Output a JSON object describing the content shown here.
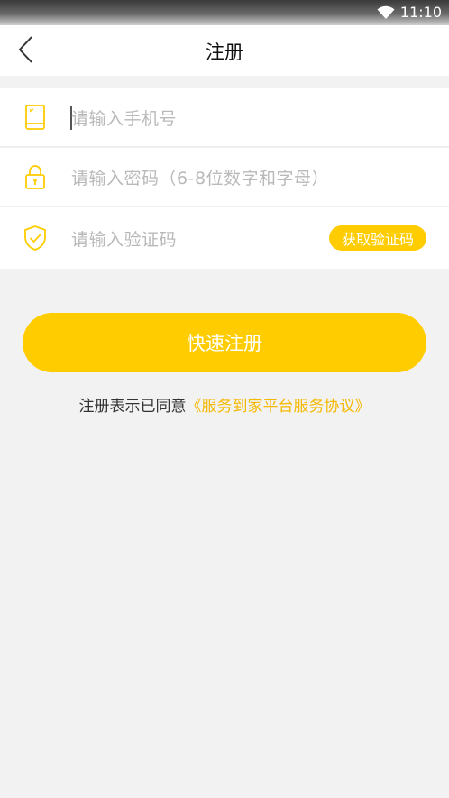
{
  "status_bar": {
    "time": "11:10",
    "wifi_icon": "wifi-icon"
  },
  "header": {
    "back_icon": "chevron-left-icon",
    "title": "注册"
  },
  "form": {
    "phone": {
      "icon": "phone-icon",
      "placeholder": "请输入手机号"
    },
    "password": {
      "icon": "lock-icon",
      "placeholder": "请输入密码（6-8位数字和字母）"
    },
    "code": {
      "icon": "shield-check-icon",
      "placeholder": "请输入验证码",
      "button_label": "获取验证码"
    }
  },
  "submit_label": "快速注册",
  "agreement": {
    "prefix": "注册表示已同意",
    "link": "《服务到家平台服务协议》"
  },
  "colors": {
    "accent": "#ffcc00",
    "link": "#f5b800",
    "background": "#f2f2f2"
  }
}
